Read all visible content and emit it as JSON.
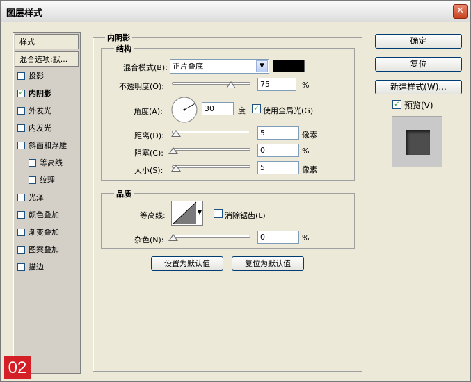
{
  "window": {
    "title": "图层样式",
    "close_glyph": "✕"
  },
  "left_panel": {
    "items": [
      {
        "label": "样式",
        "type": "header"
      },
      {
        "label": "混合选项:默...",
        "type": "header"
      },
      {
        "label": "投影",
        "checked": false
      },
      {
        "label": "内阴影",
        "checked": true,
        "active": true
      },
      {
        "label": "外发光",
        "checked": false
      },
      {
        "label": "内发光",
        "checked": false
      },
      {
        "label": "斜面和浮雕",
        "checked": false
      },
      {
        "label": "等高线",
        "checked": false,
        "indent": true
      },
      {
        "label": "纹理",
        "checked": false,
        "indent": true
      },
      {
        "label": "光泽",
        "checked": false
      },
      {
        "label": "颜色叠加",
        "checked": false
      },
      {
        "label": "渐变叠加",
        "checked": false
      },
      {
        "label": "图案叠加",
        "checked": false
      },
      {
        "label": "描边",
        "checked": false
      }
    ]
  },
  "panel": {
    "section_title": "内阴影",
    "structure": {
      "title": "结构",
      "blend_mode_label": "混合模式(B):",
      "blend_mode_value": "正片叠底",
      "blend_color": "#000000",
      "opacity_label": "不透明度(O):",
      "opacity_value": "75",
      "opacity_fraction": 0.75,
      "angle_label": "角度(A):",
      "angle_value": "30",
      "angle_unit": "度",
      "global_light_label": "使用全局光(G)",
      "global_light_checked": true,
      "distance_label": "距离(D):",
      "distance_value": "5",
      "distance_unit": "像素",
      "choke_label": "阻塞(C):",
      "choke_value": "0",
      "size_label": "大小(S):",
      "size_value": "5",
      "size_unit": "像素",
      "percent": "%"
    },
    "quality": {
      "title": "品质",
      "contour_label": "等高线:",
      "antialias_label": "消除锯齿(L)",
      "antialias_checked": false,
      "noise_label": "杂色(N):",
      "noise_value": "0",
      "percent": "%"
    },
    "buttons": {
      "set_default": "设置为默认值",
      "reset_default": "复位为默认值"
    }
  },
  "right": {
    "ok": "确定",
    "reset": "复位",
    "new_style": "新建样式(W)...",
    "preview_label": "预览(V)",
    "preview_checked": true
  },
  "badge": "02"
}
